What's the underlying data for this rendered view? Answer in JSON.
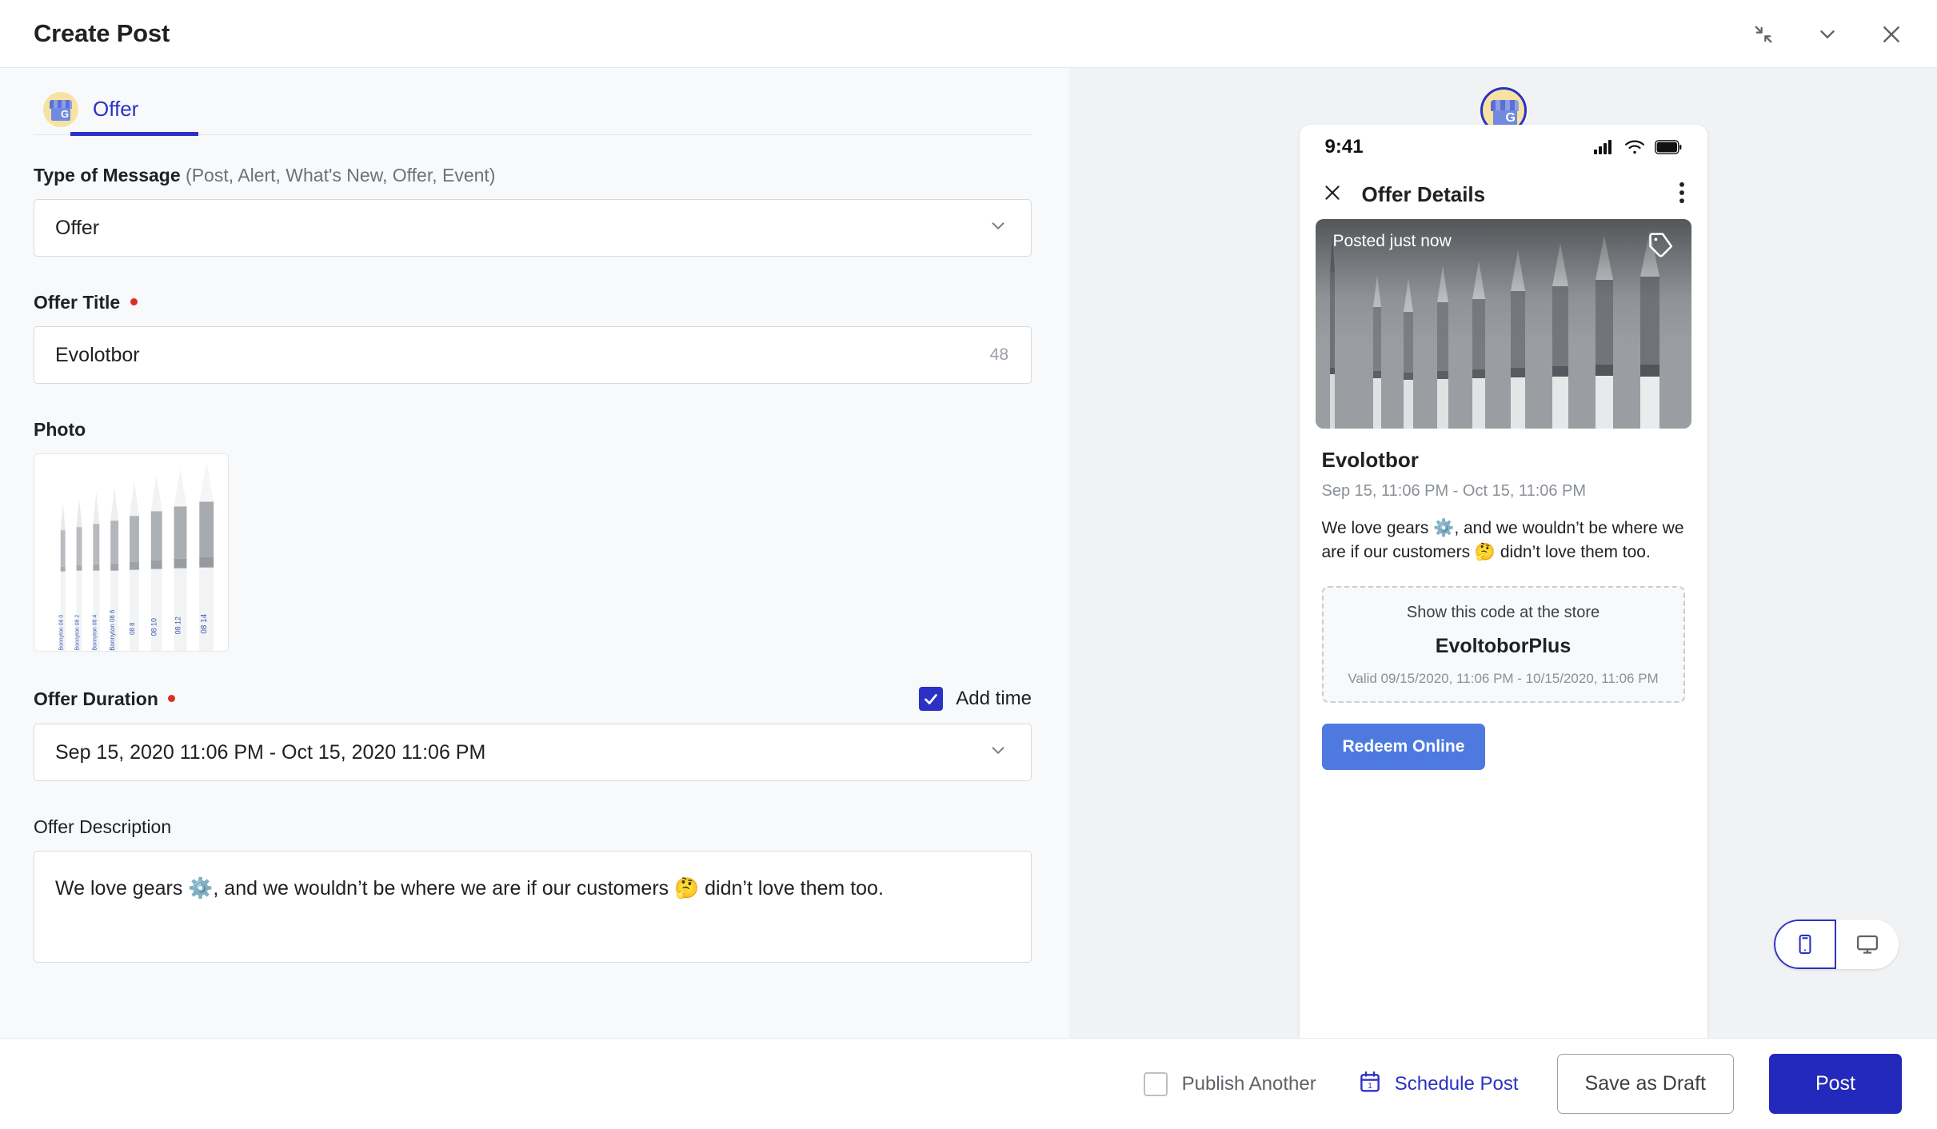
{
  "window": {
    "title": "Create Post",
    "controls": [
      {
        "name": "collapse-icon",
        "label": "Collapse"
      },
      {
        "name": "chevron-down-icon",
        "label": "Minimize"
      },
      {
        "name": "close-icon",
        "label": "Close"
      }
    ]
  },
  "tabs": [
    {
      "label": "Offer",
      "icon": "google-business-profile-icon",
      "active": true
    }
  ],
  "form": {
    "type_of_message": {
      "label": "Type of Message",
      "hint": "(Post, Alert, What's New, Offer, Event)",
      "value": "Offer",
      "options": [
        "Post",
        "Alert",
        "What's New",
        "Offer",
        "Event"
      ]
    },
    "offer_title": {
      "label": "Offer Title",
      "required": true,
      "value": "Evolotbor",
      "counter": "48"
    },
    "photo": {
      "label": "Photo",
      "alt": "Set of eight round paintbrushes arranged by size"
    },
    "offer_duration": {
      "label": "Offer Duration",
      "required": true,
      "value": "Sep 15, 2020 11:06 PM - Oct 15, 2020 11:06 PM",
      "add_time_label": "Add time",
      "add_time_checked": true
    },
    "offer_description": {
      "label": "Offer Description",
      "value": "We love gears ⚙️, and we wouldn’t be where we are if our customers 🤔 didn’t love them too."
    }
  },
  "preview": {
    "avatar_icon": "google-business-profile-icon",
    "status_bar": {
      "time": "9:41",
      "icons": [
        "signal-icon",
        "wifi-icon",
        "battery-icon"
      ]
    },
    "header": {
      "title": "Offer Details",
      "close_icon": "close-icon",
      "more_icon": "more-vertical-icon"
    },
    "hero": {
      "badge": "Posted just now",
      "tag_icon": "offer-tag-icon"
    },
    "offer_title": "Evolotbor",
    "offer_dates": "Sep 15, 11:06 PM - Oct 15, 11:06 PM",
    "offer_description": "We love gears ⚙️, and we wouldn’t be where we are if our customers 🤔 didn’t love them too.",
    "coupon": {
      "hint": "Show this code at the store",
      "code": "EvoltoborPlus",
      "valid": "Valid 09/15/2020, 11:06 PM - 10/15/2020, 11:06 PM"
    },
    "redeem_button": "Redeem Online",
    "device_toggle": {
      "mobile": "mobile-view",
      "desktop": "desktop-view",
      "selected": "mobile-view"
    }
  },
  "footer": {
    "publish_another": {
      "label": "Publish Another",
      "checked": false
    },
    "schedule_post": {
      "label": "Schedule Post",
      "icon": "calendar-icon"
    },
    "save_draft": "Save as Draft",
    "post": "Post"
  },
  "colors": {
    "brand_blue": "#2b31c4",
    "post_button": "#2329ba",
    "redeem_button": "#4e7ae0",
    "required_dot": "#d93025",
    "left_bg": "#f8f9fa",
    "right_bg": "#f1f2f4"
  }
}
